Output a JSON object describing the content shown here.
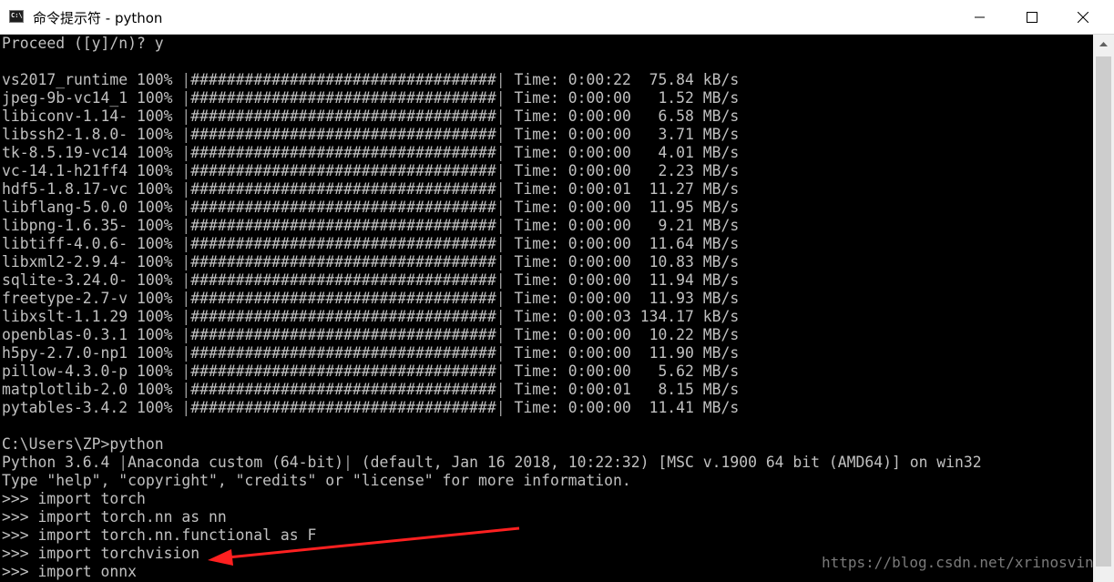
{
  "window": {
    "title": "命令提示符 - python",
    "icon": "cmd-icon",
    "icon_label": "C:\\."
  },
  "titlebar_buttons": [
    {
      "name": "minimize-button",
      "icon": "minimize-icon"
    },
    {
      "name": "maximize-button",
      "icon": "maximize-icon"
    },
    {
      "name": "close-button",
      "icon": "close-icon"
    }
  ],
  "console": {
    "prompt_line": "Proceed ([y]/n)? y",
    "progress_bar": "##################################",
    "downloads": [
      {
        "name": "vs2017_runtime",
        "pct": "100%",
        "time": "Time: 0:00:22",
        "speed": " 75.84 kB/s"
      },
      {
        "name": "jpeg-9b-vc14_1",
        "pct": "100%",
        "time": "Time: 0:00:00",
        "speed": "  1.52 MB/s"
      },
      {
        "name": "libiconv-1.14-",
        "pct": "100%",
        "time": "Time: 0:00:00",
        "speed": "  6.58 MB/s"
      },
      {
        "name": "libssh2-1.8.0-",
        "pct": "100%",
        "time": "Time: 0:00:00",
        "speed": "  3.71 MB/s"
      },
      {
        "name": "tk-8.5.19-vc14",
        "pct": "100%",
        "time": "Time: 0:00:00",
        "speed": "  4.01 MB/s"
      },
      {
        "name": "vc-14.1-h21ff4",
        "pct": "100%",
        "time": "Time: 0:00:00",
        "speed": "  2.23 MB/s"
      },
      {
        "name": "hdf5-1.8.17-vc",
        "pct": "100%",
        "time": "Time: 0:00:01",
        "speed": " 11.27 MB/s"
      },
      {
        "name": "libflang-5.0.0",
        "pct": "100%",
        "time": "Time: 0:00:00",
        "speed": " 11.95 MB/s"
      },
      {
        "name": "libpng-1.6.35-",
        "pct": "100%",
        "time": "Time: 0:00:00",
        "speed": "  9.21 MB/s"
      },
      {
        "name": "libtiff-4.0.6-",
        "pct": "100%",
        "time": "Time: 0:00:00",
        "speed": " 11.64 MB/s"
      },
      {
        "name": "libxml2-2.9.4-",
        "pct": "100%",
        "time": "Time: 0:00:00",
        "speed": " 10.83 MB/s"
      },
      {
        "name": "sqlite-3.24.0-",
        "pct": "100%",
        "time": "Time: 0:00:00",
        "speed": " 11.94 MB/s"
      },
      {
        "name": "freetype-2.7-v",
        "pct": "100%",
        "time": "Time: 0:00:00",
        "speed": " 11.93 MB/s"
      },
      {
        "name": "libxslt-1.1.29",
        "pct": "100%",
        "time": "Time: 0:00:03",
        "speed": "134.17 kB/s"
      },
      {
        "name": "openblas-0.3.1",
        "pct": "100%",
        "time": "Time: 0:00:00",
        "speed": " 10.22 MB/s"
      },
      {
        "name": "h5py-2.7.0-np1",
        "pct": "100%",
        "time": "Time: 0:00:00",
        "speed": " 11.90 MB/s"
      },
      {
        "name": "pillow-4.3.0-p",
        "pct": "100%",
        "time": "Time: 0:00:00",
        "speed": "  5.62 MB/s"
      },
      {
        "name": "matplotlib-2.0",
        "pct": "100%",
        "time": "Time: 0:00:01",
        "speed": "  8.15 MB/s"
      },
      {
        "name": "pytables-3.4.2",
        "pct": "100%",
        "time": "Time: 0:00:00",
        "speed": " 11.41 MB/s"
      }
    ],
    "command_line": "C:\\Users\\ZP>python",
    "python_banner_a": "Python 3.6.4 ",
    "python_banner_b": "Anaconda custom (64-bit)",
    "python_banner_c": " (default, Jan 16 2018, 10:22:32) [MSC v.1900 64 bit (AMD64)] on win32",
    "python_help": "Type \"help\", \"copyright\", \"credits\" or \"license\" for more information.",
    "repl_lines": [
      ">>> import torch",
      ">>> import torch.nn as nn",
      ">>> import torch.nn.functional as F",
      ">>> import torchvision",
      ">>> import onnx"
    ]
  },
  "scrollbar": {
    "up_icon": "scroll-up-arrow-icon",
    "position": 0.97
  },
  "annotation": {
    "icon": "red-arrow-icon",
    "color": "#ff2020"
  },
  "watermark": "https://blog.csdn.net/xrinosvin"
}
